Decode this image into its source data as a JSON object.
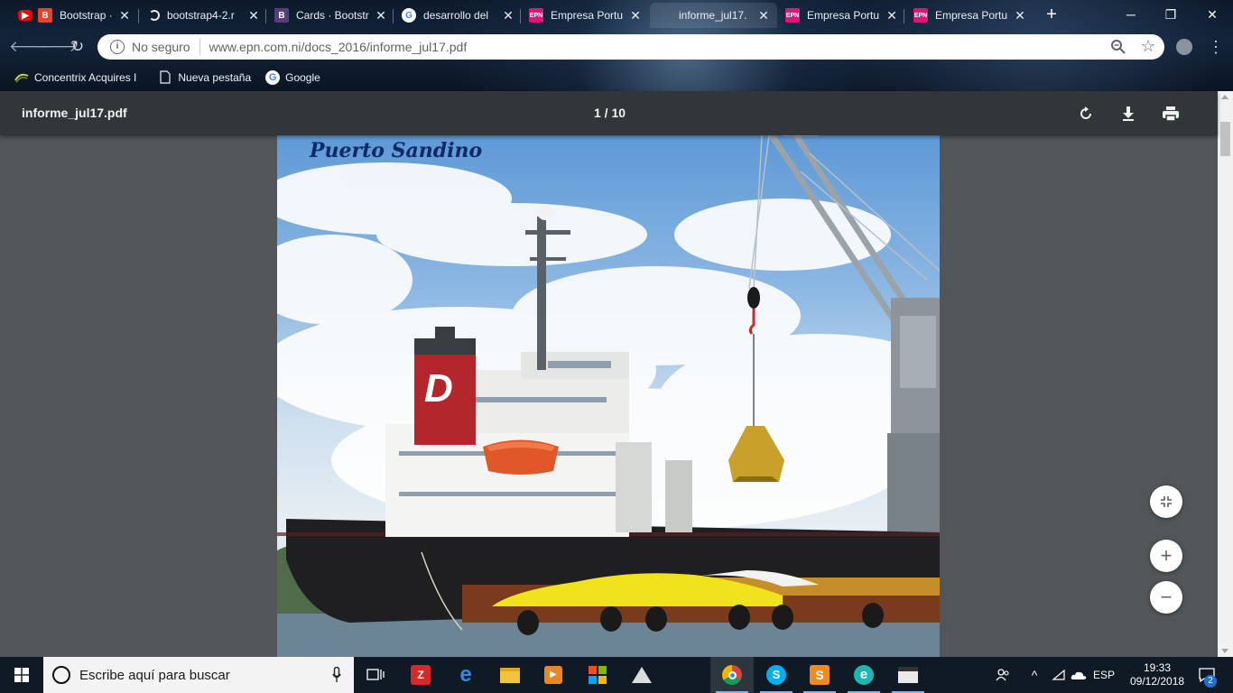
{
  "browser": {
    "tabs": [
      {
        "title": "Bootstrap ·",
        "favicon": "youtube-icon",
        "color": "#ff0000"
      },
      {
        "title": "bootstrap4-2.r",
        "favicon": "loading-icon",
        "color": "#ffffff"
      },
      {
        "title": "Cards · Bootstr",
        "favicon": "bootstrap-icon",
        "color": "#563d7c"
      },
      {
        "title": "desarrollo del",
        "favicon": "google-icon",
        "color": "#4285f4"
      },
      {
        "title": "Empresa Portu",
        "favicon": "epn-icon",
        "color": "#e2127a"
      },
      {
        "title": "informe_jul17.",
        "favicon": "pdf-icon",
        "color": "#ffffff",
        "active": true
      },
      {
        "title": "Empresa Portu",
        "favicon": "epn-icon",
        "color": "#e2127a"
      },
      {
        "title": "Empresa Portu",
        "favicon": "epn-icon",
        "color": "#e2127a"
      }
    ],
    "omnibox": {
      "security_label": "No seguro",
      "url": "www.epn.com.ni/docs_2016/informe_jul17.pdf"
    },
    "bookmarks": [
      {
        "label": "Concentrix Acquires I",
        "icon": "concentrix-icon"
      },
      {
        "label": "Nueva pestaña",
        "icon": "page-icon"
      },
      {
        "label": "Google",
        "icon": "google-icon"
      }
    ]
  },
  "pdf": {
    "filename": "informe_jul17.pdf",
    "page_indicator": "1 / 10",
    "page_caption": "Puerto Sandino"
  },
  "taskbar": {
    "search_placeholder": "Escribe aquí para buscar",
    "language": "ESP",
    "time": "19:33",
    "date": "09/12/2018",
    "notifications_count": "2"
  },
  "colors": {
    "pdf_toolbar": "#323639",
    "viewer_background": "#525659",
    "taskbar": "#101a24",
    "funnel_red": "#b3262b"
  }
}
